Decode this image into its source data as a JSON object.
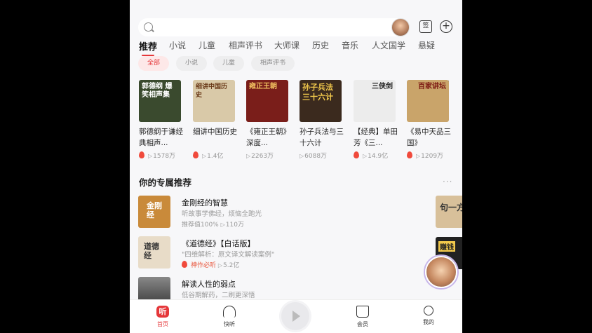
{
  "tabs": [
    "推荐",
    "小说",
    "儿童",
    "相声评书",
    "大师课",
    "历史",
    "音乐",
    "人文国学",
    "悬疑"
  ],
  "chips": [
    "全部",
    "小说",
    "儿童",
    "相声评书"
  ],
  "books": [
    {
      "title": "郭德纲于谦经典相声...",
      "cover_text": "郭德纲 爆笑相声集",
      "plays": "1578万",
      "hot": true,
      "color": "#3a4a2e"
    },
    {
      "title": "细讲中国历史",
      "cover_text": "细讲中国历史",
      "plays": "1.4亿",
      "hot": true,
      "color": "#d9c9a8"
    },
    {
      "title": "《雍正王朝》深度...",
      "cover_text": "雍正王朝",
      "plays": "2263万",
      "hot": false,
      "color": "#7a1e1a"
    },
    {
      "title": "孙子兵法与三十六计",
      "cover_text": "孙子兵法 三十六计",
      "plays": "6088万",
      "hot": false,
      "color": "#3b2a1e"
    },
    {
      "title": "【经典】单田芳《三...",
      "cover_text": "三侠剑",
      "plays": "14.9亿",
      "hot": true,
      "color": "#ececec"
    },
    {
      "title": "《易中天品三国》",
      "cover_text": "百家讲坛",
      "plays": "1209万",
      "hot": true,
      "color": "#c9a46a"
    }
  ],
  "section": {
    "title": "你的专属推荐",
    "more": "···"
  },
  "list": [
    {
      "title": "金刚经的智慧",
      "desc": "听故事学佛经，烦恼全跑光",
      "meta_a": "推荐值100%",
      "meta_b": "110万",
      "tag": "",
      "color": "#c98a3a",
      "cover_text": "金刚经"
    },
    {
      "title": "《道德经》【白话版】",
      "desc": "\"四维解析：原文译文解读案例\"",
      "meta_a": "",
      "meta_b": "5.2亿",
      "tag": "神作必听",
      "color": "#e8dcc8",
      "cover_text": "道德经"
    },
    {
      "title": "解读人性的弱点",
      "desc": "低谷期解药，二刷更深悟",
      "meta_a": "",
      "meta_b": "",
      "tag": "",
      "color": "#555",
      "cover_text": ""
    }
  ],
  "side_covers": [
    {
      "text": "句一方",
      "color": "#d8c09a"
    },
    {
      "text": "赚钱",
      "color": "#222"
    }
  ],
  "nav": [
    {
      "label": "首页",
      "icon_char": "听"
    },
    {
      "label": "快听",
      "icon_char": ""
    },
    {
      "label": "",
      "icon_char": ""
    },
    {
      "label": "会员",
      "icon_char": ""
    },
    {
      "label": "我的",
      "icon_char": ""
    }
  ],
  "search": {
    "placeholder": ""
  },
  "sign_icon_char": "签"
}
